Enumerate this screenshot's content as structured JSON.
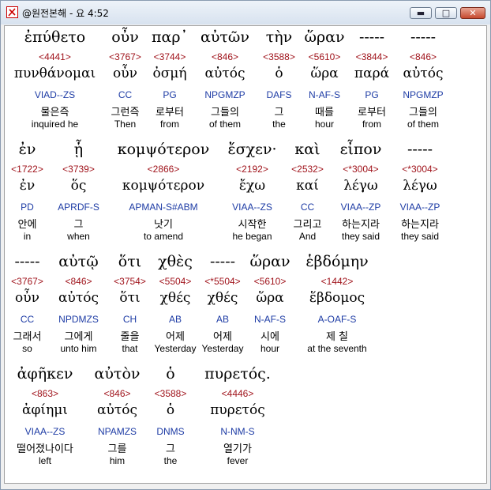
{
  "window": {
    "title": "@원전본해 - 요 4:52"
  },
  "buttons": {
    "minimize": "▬",
    "maximize": "□",
    "close": "✕"
  },
  "rows": [
    [
      {
        "gk": "ἐπύθετο",
        "sn": "<4441>",
        "lm": "πυνθάνομαι",
        "ps": "VIAD--ZS",
        "ko": "물은즉",
        "en": "inquired he"
      },
      {
        "gk": "οὖν",
        "sn": "<3767>",
        "lm": "οὖν",
        "ps": "CC",
        "ko": "그런즉",
        "en": "Then"
      },
      {
        "gk": "παρ᾽",
        "sn": "<3744>",
        "lm": "ὀσμή",
        "ps": "PG",
        "ko": "로부터",
        "en": "from"
      },
      {
        "gk": "αὐτῶν",
        "sn": "<846>",
        "lm": "αὐτός",
        "ps": "NPGMZP",
        "ko": "그들의",
        "en": "of them"
      },
      {
        "gk": "τὴν",
        "sn": "<3588>",
        "lm": "ὁ",
        "ps": "DAFS",
        "ko": "그",
        "en": "the"
      },
      {
        "gk": "ὥραν",
        "sn": "<5610>",
        "lm": "ὥρα",
        "ps": "N-AF-S",
        "ko": "때를",
        "en": "hour"
      },
      {
        "gk": "-----",
        "sn": "<3844>",
        "lm": "παρά",
        "ps": "PG",
        "ko": "로부터",
        "en": "from"
      },
      {
        "gk": "-----",
        "sn": "<846>",
        "lm": "αὐτός",
        "ps": "NPGMZP",
        "ko": "그들의",
        "en": "of them"
      }
    ],
    [
      {
        "gk": "ἐν",
        "sn": "<1722>",
        "lm": "ἐν",
        "ps": "PD",
        "ko": "안에",
        "en": "in"
      },
      {
        "gk": "ᾗ",
        "sn": "<3739>",
        "lm": "ὅς",
        "ps": "APRDF-S",
        "ko": "그",
        "en": "when"
      },
      {
        "gk": "κομψότερον",
        "sn": "<2866>",
        "lm": "κομψότερον",
        "ps": "APMAN-S#ABM",
        "ko": "낫기",
        "en": "to amend"
      },
      {
        "gk": "ἔσχεν·",
        "sn": "<2192>",
        "lm": "ἔχω",
        "ps": "VIAA--ZS",
        "ko": "시작한",
        "en": "he began"
      },
      {
        "gk": "καὶ",
        "sn": "<2532>",
        "lm": "καί",
        "ps": "CC",
        "ko": "그리고",
        "en": "And"
      },
      {
        "gk": "εἶπον",
        "sn": "<*3004>",
        "lm": "λέγω",
        "ps": "VIAA--ZP",
        "ko": "하는지라",
        "en": "they said"
      },
      {
        "gk": "-----",
        "sn": "<*3004>",
        "lm": "λέγω",
        "ps": "VIAA--ZP",
        "ko": "하는지라",
        "en": "they said"
      }
    ],
    [
      {
        "gk": "-----",
        "sn": "<3767>",
        "lm": "οὖν",
        "ps": "CC",
        "ko": "그래서",
        "en": "so"
      },
      {
        "gk": "αὐτῷ",
        "sn": "<846>",
        "lm": "αὐτός",
        "ps": "NPDMZS",
        "ko": "그에게",
        "en": "unto him"
      },
      {
        "gk": "ὅτι",
        "sn": "<3754>",
        "lm": "ὅτι",
        "ps": "CH",
        "ko": "줄을",
        "en": "that"
      },
      {
        "gk": "χθὲς",
        "sn": "<5504>",
        "lm": "χθές",
        "ps": "AB",
        "ko": "어제",
        "en": "Yesterday"
      },
      {
        "gk": "-----",
        "sn": "<*5504>",
        "lm": "χθές",
        "ps": "AB",
        "ko": "어제",
        "en": "Yesterday"
      },
      {
        "gk": "ὥραν",
        "sn": "<5610>",
        "lm": "ὥρα",
        "ps": "N-AF-S",
        "ko": "시에",
        "en": "hour"
      },
      {
        "gk": "ἑβδόμην",
        "sn": "<1442>",
        "lm": "ἕβδομος",
        "ps": "A-OAF-S",
        "ko": "제 칠",
        "en": "at the seventh"
      }
    ],
    [
      {
        "gk": "ἀφῆκεν",
        "sn": "<863>",
        "lm": "ἀφίημι",
        "ps": "VIAA--ZS",
        "ko": "떨어졌나이다",
        "en": "left"
      },
      {
        "gk": "αὐτὸν",
        "sn": "<846>",
        "lm": "αὐτός",
        "ps": "NPAMZS",
        "ko": "그를",
        "en": "him"
      },
      {
        "gk": "ὁ",
        "sn": "<3588>",
        "lm": "ὁ",
        "ps": "DNMS",
        "ko": "그",
        "en": "the"
      },
      {
        "gk": "πυρετός.",
        "sn": "<4446>",
        "lm": "πυρετός",
        "ps": "N-NM-S",
        "ko": "열기가",
        "en": "fever"
      }
    ]
  ]
}
